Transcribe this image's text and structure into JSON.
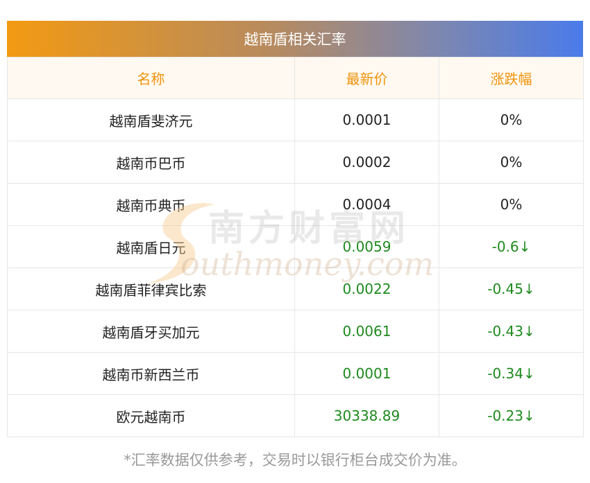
{
  "title": "越南盾相关汇率",
  "columns": {
    "name": "名称",
    "price": "最新价",
    "change": "涨跌幅"
  },
  "rows": [
    {
      "name": "越南盾斐济元",
      "price": "0.0001",
      "change": "0%",
      "trend": "flat"
    },
    {
      "name": "越南币巴币",
      "price": "0.0002",
      "change": "0%",
      "trend": "flat"
    },
    {
      "name": "越南币典币",
      "price": "0.0004",
      "change": "0%",
      "trend": "flat"
    },
    {
      "name": "越南盾日元",
      "price": "0.0059",
      "change": "-0.6↓",
      "trend": "down"
    },
    {
      "name": "越南盾菲律宾比索",
      "price": "0.0022",
      "change": "-0.45↓",
      "trend": "down"
    },
    {
      "name": "越南盾牙买加元",
      "price": "0.0061",
      "change": "-0.43↓",
      "trend": "down"
    },
    {
      "name": "越南币新西兰币",
      "price": "0.0001",
      "change": "-0.34↓",
      "trend": "down"
    },
    {
      "name": "欧元越南币",
      "price": "30338.89",
      "change": "-0.23↓",
      "trend": "down"
    }
  ],
  "watermark": {
    "text_cn": "南方财富网",
    "text_en": "outhmoney.com"
  },
  "footnote": "*汇率数据仅供参考，交易时以银行柜台成交价为准。",
  "colors": {
    "header_text": "#f0930c",
    "down": "#1e8a1e",
    "gradient_start": "#f39a12",
    "gradient_end": "#4a7bea"
  }
}
